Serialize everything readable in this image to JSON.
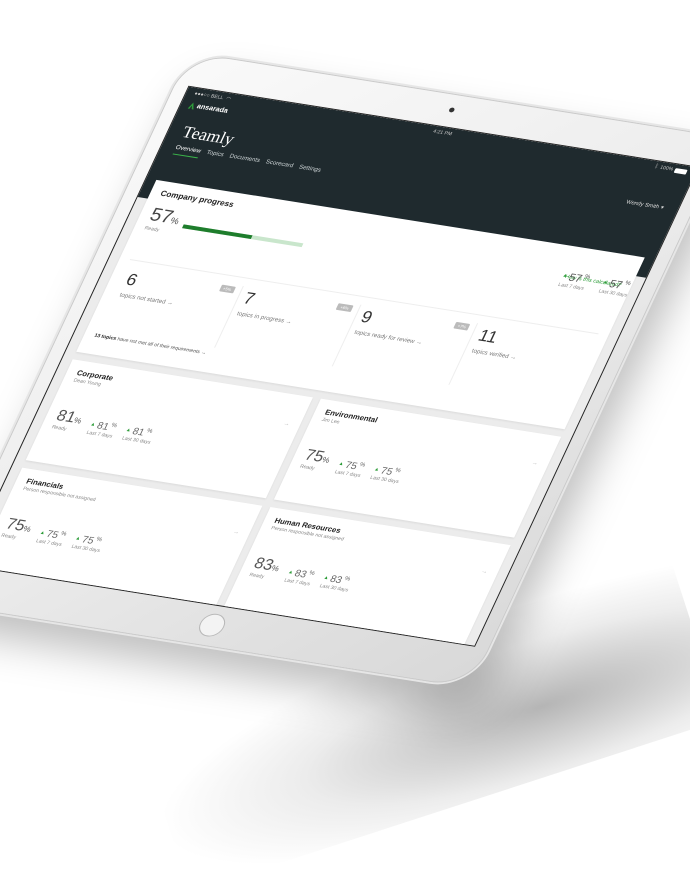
{
  "status_bar": {
    "carrier": "●●●○○ BELL",
    "wifi_icon": "wifi-icon",
    "time": "4:21 PM",
    "battery": "100%"
  },
  "brand": {
    "name": "ansarada",
    "color": "#2e9d3a"
  },
  "header": {
    "title": "Teamly",
    "user": "Wendy Smith"
  },
  "nav": {
    "tabs": [
      "Overview",
      "Topics",
      "Documents",
      "Scorecard",
      "Settings"
    ],
    "active": "Overview"
  },
  "colors": {
    "header_bg": "#1f2a2e",
    "accent": "#2e9d3a",
    "progress_fill": "#1e7d2c",
    "progress_track": "#c9e6cc"
  },
  "company_progress": {
    "title": "Company progress",
    "value": "57",
    "unit": "%",
    "ready_label": "Ready",
    "progress_fraction": 0.57,
    "calc_link": "How is this calculated?",
    "last7": {
      "value": "57",
      "unit": "%",
      "label": "Last 7 days"
    },
    "last30": {
      "value": "57",
      "unit": "%",
      "label": "Last 30 days"
    },
    "counts": [
      {
        "num": "6",
        "label": "topics not started →",
        "badge": "+5%"
      },
      {
        "num": "7",
        "label": "topics in progress →",
        "badge": "+6%"
      },
      {
        "num": "9",
        "label": "topics ready for review →",
        "badge": "+7%"
      },
      {
        "num": "11",
        "label": "topics verified →",
        "badge": ""
      }
    ],
    "requirements_count": "13 topics",
    "requirements_text": "have not met all of their requirements →"
  },
  "areas": [
    {
      "title": "Corporate",
      "owner": "Dean Young",
      "value": "81",
      "ready": "Ready",
      "last7": "81",
      "last7_label": "Last 7 days",
      "last30": "81",
      "last30_label": "Last 30 days"
    },
    {
      "title": "Environmental",
      "owner": "Jim Lee",
      "value": "75",
      "ready": "Ready",
      "last7": "75",
      "last7_label": "Last 7 days",
      "last30": "75",
      "last30_label": "Last 30 days"
    },
    {
      "title": "Financials",
      "owner": "Person responsible not assigned",
      "value": "75",
      "ready": "Ready",
      "last7": "75",
      "last7_label": "Last 7 days",
      "last30": "75",
      "last30_label": "Last 30 days"
    },
    {
      "title": "Human Resources",
      "owner": "Person responsible not assigned",
      "value": "83",
      "ready": "Ready",
      "last7": "83",
      "last7_label": "Last 7 days",
      "last30": "83",
      "last30_label": "Last 30 days"
    }
  ]
}
